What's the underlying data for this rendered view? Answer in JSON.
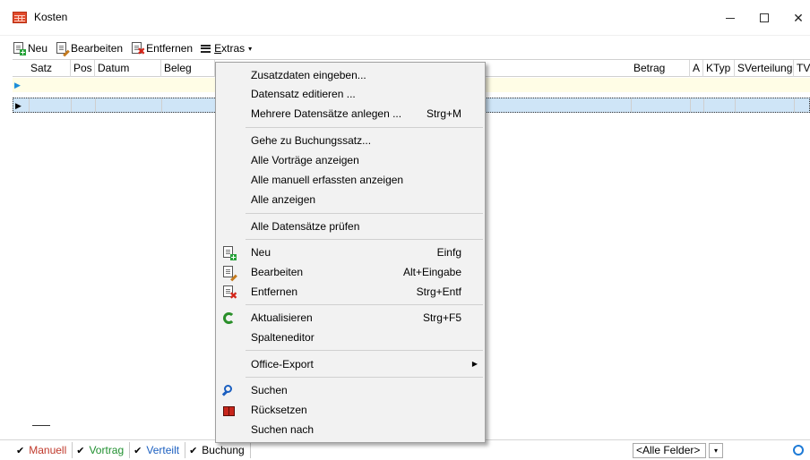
{
  "window": {
    "title": "Kosten",
    "min_glyph": "—",
    "max_glyph": "☐",
    "close_glyph": "✕"
  },
  "toolbar": {
    "new_label": "Neu",
    "edit_label": "Bearbeiten",
    "delete_label": "Entfernen",
    "extras_prefix": "",
    "extras_key": "E",
    "extras_rest": "xtras",
    "extras_arrow": "▾"
  },
  "grid": {
    "columns": [
      "Satz",
      "Pos",
      "Datum",
      "Beleg",
      "Betrag",
      "A",
      "KTyp",
      "SVerteilung",
      "TV"
    ],
    "row_indicator_new": "▶",
    "row_indicator_current": "▶"
  },
  "menu": {
    "items": [
      {
        "label": "Zusatzdaten eingeben...",
        "shortcut": ""
      },
      {
        "label": "Datensatz editieren ...",
        "shortcut": ""
      },
      {
        "label": "Mehrere Datensätze anlegen ...",
        "shortcut": "Strg+M"
      },
      {
        "label": "Gehe zu Buchungssatz...",
        "shortcut": ""
      },
      {
        "label": "Alle Vorträge anzeigen",
        "shortcut": ""
      },
      {
        "label": "Alle manuell erfassten anzeigen",
        "shortcut": ""
      },
      {
        "label": "Alle anzeigen",
        "shortcut": ""
      },
      {
        "label": "Alle Datensätze prüfen",
        "shortcut": ""
      },
      {
        "label": "Neu",
        "shortcut": "Einfg",
        "icon": "new-doc-icon"
      },
      {
        "label": "Bearbeiten",
        "shortcut": "Alt+Eingabe",
        "icon": "edit-doc-icon"
      },
      {
        "label": "Entfernen",
        "shortcut": "Strg+Entf",
        "icon": "delete-doc-icon"
      },
      {
        "label": "Aktualisieren",
        "shortcut": "Strg+F5",
        "icon": "refresh-icon"
      },
      {
        "label": "Spalteneditor",
        "shortcut": ""
      },
      {
        "label": "Office-Export",
        "shortcut": "",
        "submenu_arrow": "▶"
      },
      {
        "label": "Suchen",
        "shortcut": "",
        "icon": "search-icon"
      },
      {
        "label": "Rücksetzen",
        "shortcut": "",
        "icon": "binoculars-icon"
      },
      {
        "label": "Suchen nach",
        "shortcut": ""
      }
    ]
  },
  "statusbar": {
    "check": "✔",
    "filters": [
      {
        "label": "Manuell",
        "color": "#c0392b"
      },
      {
        "label": "Vortrag",
        "color": "#1e8f2e"
      },
      {
        "label": "Verteilt",
        "color": "#1b5fc0"
      },
      {
        "label": "Buchung",
        "color": "#000000"
      }
    ],
    "field_select": "<Alle Felder>",
    "dropdown_glyph": "▾"
  }
}
